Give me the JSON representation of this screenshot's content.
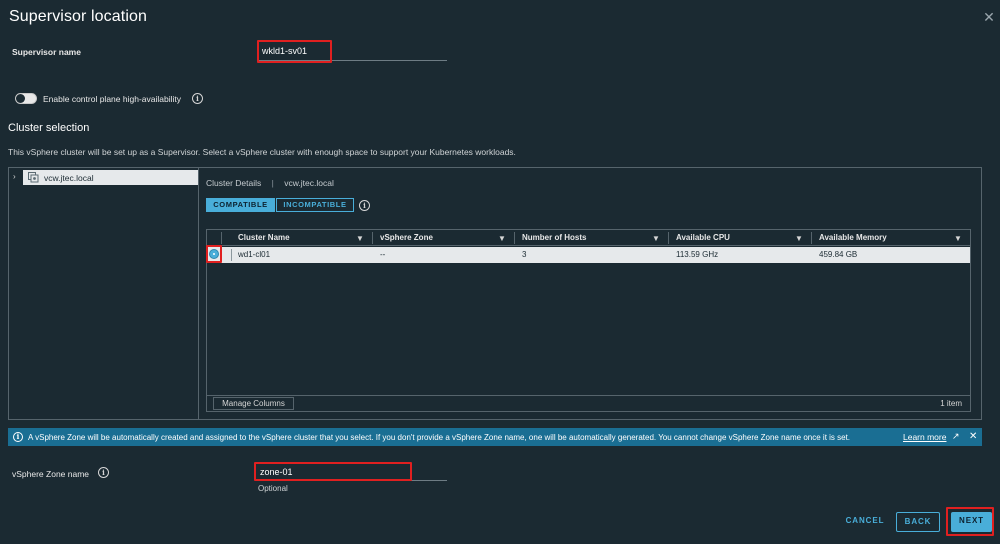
{
  "dialog": {
    "title": "Supervisor location",
    "close_label": "✕"
  },
  "supervisor_name": {
    "label": "Supervisor name",
    "value": "wkld1-sv01"
  },
  "ha_toggle": {
    "label": "Enable control plane high-availability",
    "enabled": false
  },
  "cluster_selection": {
    "heading": "Cluster selection",
    "description": "This vSphere cluster will be set up as a Supervisor. Select a vSphere cluster with enough space to support your Kubernetes workloads.",
    "tree": {
      "caret": "›",
      "root_label": "vcw.jtec.local"
    },
    "details": {
      "label": "Cluster Details",
      "separator": "|",
      "context": "vcw.jtec.local"
    },
    "tabs": [
      {
        "label": "COMPATIBLE",
        "active": true
      },
      {
        "label": "INCOMPATIBLE",
        "active": false
      }
    ],
    "grid": {
      "columns": [
        "Cluster Name",
        "vSphere Zone",
        "Number of Hosts",
        "Available CPU",
        "Available Memory"
      ],
      "rows": [
        {
          "selected": true,
          "cells": [
            "wd1-cl01",
            "--",
            "3",
            "113.59 GHz",
            "459.84 GB"
          ]
        }
      ],
      "manage_columns_label": "Manage Columns",
      "item_count": "1 item"
    }
  },
  "info_banner": {
    "text": "A vSphere Zone will be automatically created and assigned to the vSphere cluster that you select. If you don't provide a vSphere Zone name, one will be automatically generated. You cannot change vSphere Zone name once it is set.",
    "link_label": "Learn more",
    "close_label": "✕"
  },
  "zone_name": {
    "label": "vSphere Zone name",
    "value": "zone-01",
    "hint": "Optional"
  },
  "footer": {
    "cancel_label": "CANCEL",
    "back_label": "BACK",
    "next_label": "NEXT"
  },
  "colors": {
    "background": "#1b2a32",
    "accent": "#49aed9",
    "info_bar": "#1a6e93",
    "highlight_box": "#e02020"
  },
  "icons": [
    "close-icon",
    "info-icon",
    "caret-right-icon",
    "cluster-icon",
    "filter-icon",
    "radio-selected-icon",
    "external-link-icon"
  ]
}
